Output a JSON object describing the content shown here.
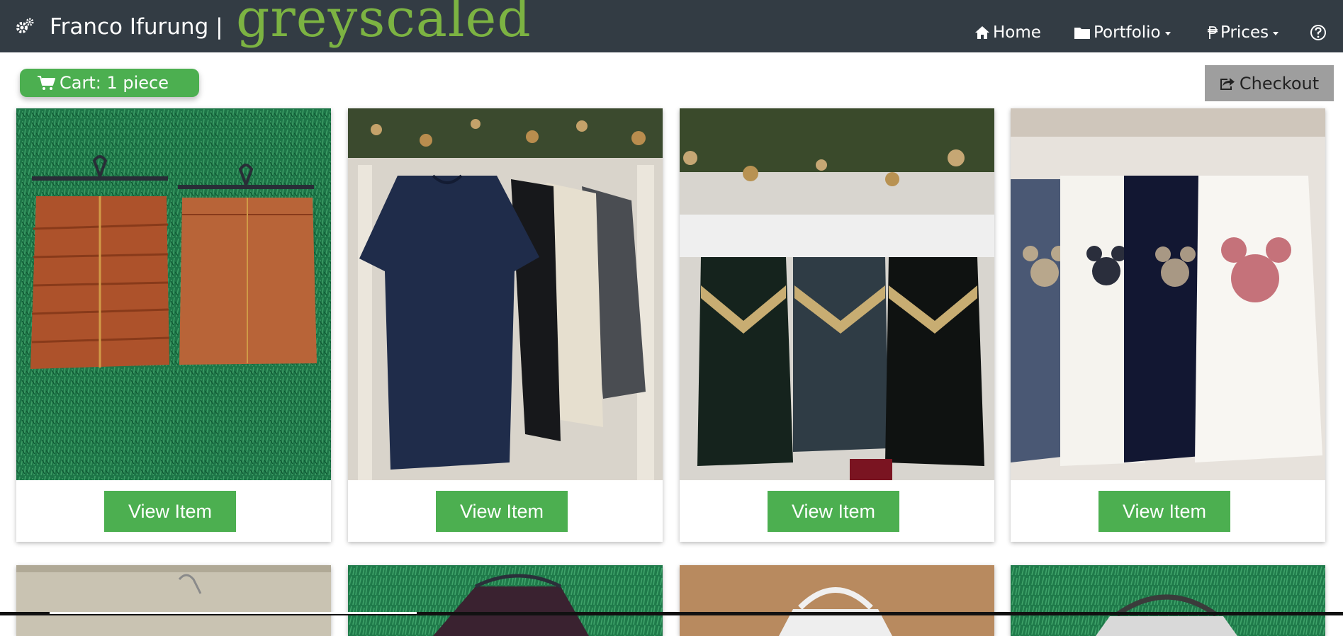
{
  "header": {
    "brand": "Franco Ifurung |",
    "logo": "greyscaled",
    "nav": [
      {
        "label": "Home",
        "icon": "home-icon"
      },
      {
        "label": "Portfolio",
        "icon": "folder-icon",
        "dropdown": true
      },
      {
        "label": "Prices",
        "icon": "peso-icon",
        "dropdown": true
      }
    ],
    "help_icon": "question-circle-icon",
    "brand_icon": "gears-icon"
  },
  "cart": {
    "label": "Cart: 1 piece",
    "icon": "cart-icon"
  },
  "checkout": {
    "label": "Checkout",
    "icon": "share-icon"
  },
  "products": [
    {
      "button": "View Item",
      "photo": "two leather pencil skirts on hangers against artificial grass"
    },
    {
      "button": "View Item",
      "photo": "navy and black knit tops on hangers under christmas garland"
    },
    {
      "button": "View Item",
      "photo": "velvet camisoles with sequin neckline on hangers"
    },
    {
      "button": "View Item",
      "photo": "long-sleeve tops with mouse sequin design on hangers"
    }
  ],
  "colors": {
    "navbar": "#333c44",
    "accent": "#4caf50",
    "logo": "#7cb342",
    "checkout": "#9e9e9e"
  }
}
